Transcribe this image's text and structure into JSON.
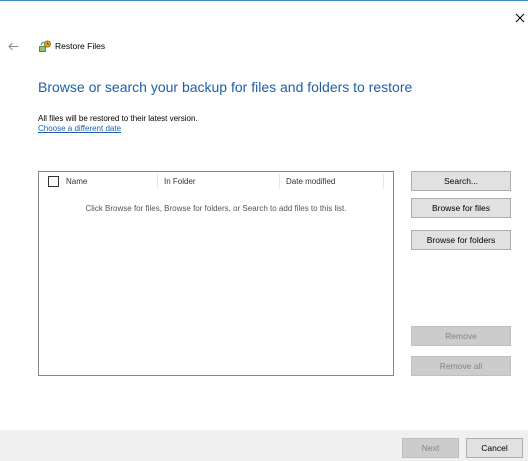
{
  "window": {
    "title": "Restore Files"
  },
  "main": {
    "heading": "Browse or search your backup for files and folders to restore",
    "info_text": "All files will be restored to their latest version.",
    "choose_date_link": "Choose a different date"
  },
  "file_list": {
    "columns": [
      "Name",
      "In Folder",
      "Date modified"
    ],
    "empty_hint": "Click Browse for files, Browse for folders, or Search to add files to this list."
  },
  "buttons": {
    "search": "Search...",
    "browse_files": "Browse for files",
    "browse_folders": "Browse for folders",
    "remove": "Remove",
    "remove_all": "Remove all",
    "next": "Next",
    "cancel": "Cancel"
  },
  "colors": {
    "accent": "#1f5faa",
    "window_border": "#3c8fc4"
  }
}
